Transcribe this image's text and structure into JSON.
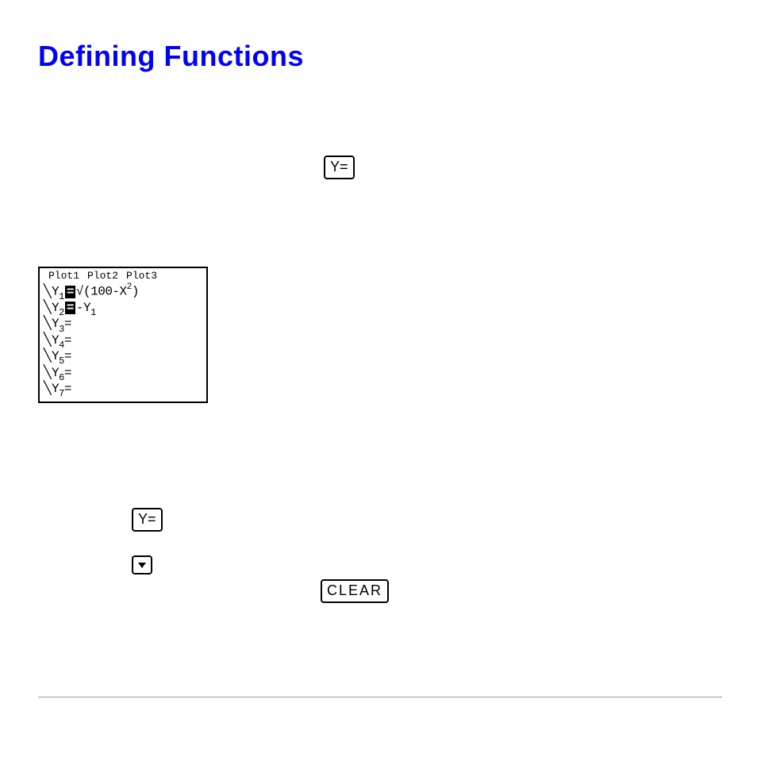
{
  "title": "Defining Functions",
  "keys": {
    "y_equals": "Y=",
    "clear": "CLEAR"
  },
  "calc": {
    "plots": [
      "Plot1",
      "Plot2",
      "Plot3"
    ],
    "lines": {
      "y1": {
        "label": "Y",
        "sub": "1",
        "expr_prefix": "√(100-X",
        "expr_sup": "2",
        "expr_suffix": ")"
      },
      "y2": {
        "label": "Y",
        "sub": "2",
        "expr": "-Y",
        "expr_sub": "1"
      },
      "y3": {
        "label": "Y",
        "sub": "3",
        "eq": "="
      },
      "y4": {
        "label": "Y",
        "sub": "4",
        "eq": "="
      },
      "y5": {
        "label": "Y",
        "sub": "5",
        "eq": "="
      },
      "y6": {
        "label": "Y",
        "sub": "6",
        "eq": "="
      },
      "y7": {
        "label": "Y",
        "sub": "7",
        "eq": "="
      }
    }
  }
}
